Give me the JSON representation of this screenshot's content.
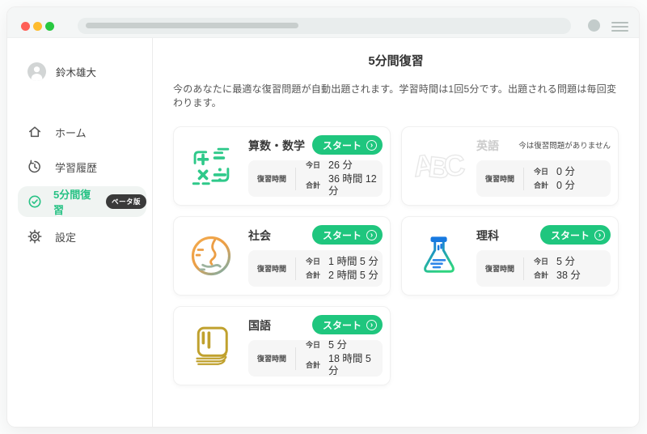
{
  "browser_chrome": {
    "traffic_light_icons": [
      "close-circle-icon",
      "minimize-circle-icon",
      "fullscreen-circle-icon"
    ],
    "address_bar_value": "",
    "avatar_icon": "user-avatar-icon",
    "menu_icon": "hamburger-menu-icon"
  },
  "sidebar": {
    "user": {
      "name": "鈴木雄大",
      "avatar_icon": "person-icon"
    },
    "items": [
      {
        "label": "ホーム",
        "icon": "home-icon",
        "active": false
      },
      {
        "label": "学習履歴",
        "icon": "history-icon",
        "active": false
      },
      {
        "label": "5分間復習",
        "icon": "check-circle-icon",
        "badge": "ベータ版",
        "active": true
      },
      {
        "label": "設定",
        "icon": "gear-icon",
        "active": false
      }
    ]
  },
  "main": {
    "title": "5分間復習",
    "description": "今のあなたに最適な復習問題が自動出題されます。学習時間は1回5分です。出題される問題は毎回変わります。",
    "labels": {
      "start": "スタート",
      "review_time": "復習時間",
      "today": "今日",
      "total": "合計"
    },
    "subjects": [
      {
        "id": "math",
        "name": "算数・数学",
        "icon": "math-symbols-icon",
        "startable": true,
        "today": "26 分",
        "total": "36 時間 12 分"
      },
      {
        "id": "english",
        "name": "英語",
        "icon": "abc-letters-icon",
        "startable": false,
        "note": "今は復習問題がありません",
        "today": "0 分",
        "total": "0 分"
      },
      {
        "id": "social",
        "name": "社会",
        "icon": "globe-icon",
        "startable": true,
        "today": "1 時間 5 分",
        "total": "2 時間 5 分"
      },
      {
        "id": "science",
        "name": "理科",
        "icon": "flask-icon",
        "startable": true,
        "today": "5 分",
        "total": "38 分"
      },
      {
        "id": "japanese",
        "name": "国語",
        "icon": "book-icon",
        "startable": true,
        "today": "5 分",
        "total": "18 時間 5 分"
      }
    ]
  },
  "colors": {
    "accent_green": "#1fc67e",
    "active_menu_green": "#27c285",
    "badge_bg": "#3a3a3a",
    "math_green": "#2fc98a",
    "social_orange": "#ec9e45",
    "science_blue": "#1779e0",
    "science_green": "#2ed47f",
    "japanese_gold": "#c0a12e"
  }
}
